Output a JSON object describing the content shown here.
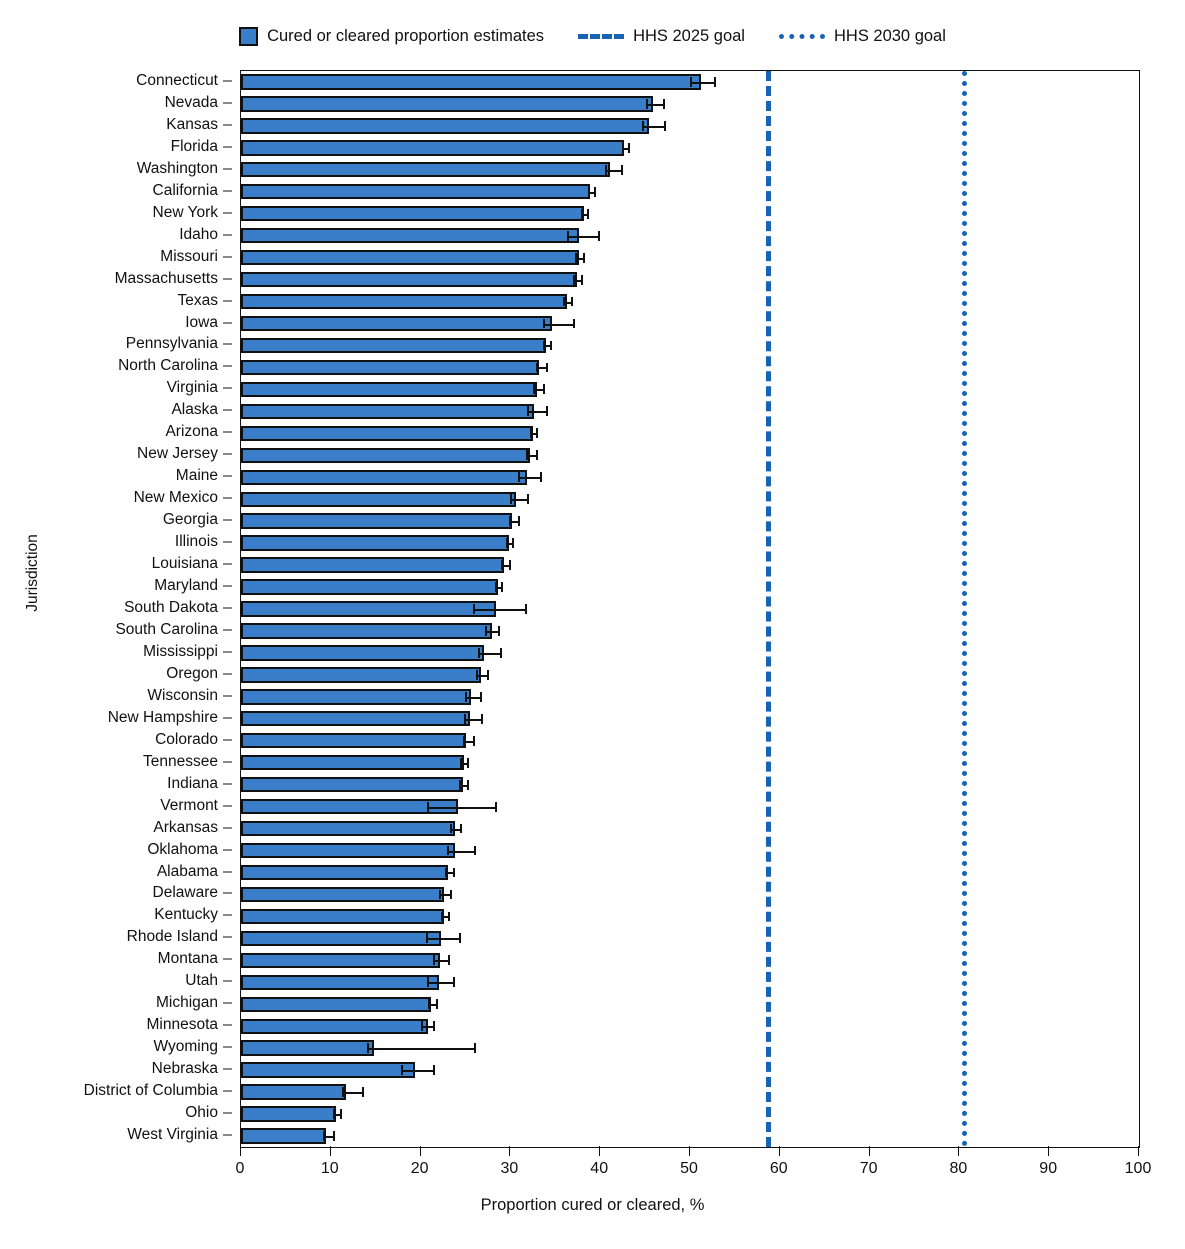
{
  "legend": {
    "items": [
      {
        "name": "bar-series",
        "label": "Cured or cleared proportion estimates",
        "marker": "filled-square",
        "color": "#3A7DC9"
      },
      {
        "name": "hhs-2025-goal",
        "label": "HHS 2025 goal",
        "marker": "dashed-line",
        "color": "#1763B6"
      },
      {
        "name": "hhs-2030-goal",
        "label": "HHS 2030 goal",
        "marker": "dotted-line",
        "color": "#1763B6"
      }
    ]
  },
  "axes": {
    "x_title": "Proportion cured or cleared, %",
    "y_title": "Jurisdiction",
    "x_ticks": [
      0,
      10,
      20,
      30,
      40,
      50,
      60,
      70,
      80,
      90,
      100
    ]
  },
  "chart_data": {
    "type": "bar",
    "orientation": "horizontal",
    "title": "",
    "xlabel": "Proportion cured or cleared, %",
    "ylabel": "Jurisdiction",
    "xlim": [
      0,
      100
    ],
    "xticks": [
      0,
      10,
      20,
      30,
      40,
      50,
      60,
      70,
      80,
      90,
      100
    ],
    "grid": false,
    "legend_position": "top-center",
    "bar_color": "#3A7DC9",
    "bar_edge_color": "#111111",
    "error_bars": "95% confidence interval",
    "reference_lines": [
      {
        "label": "HHS 2025 goal",
        "value": 58.5,
        "style": "dashed",
        "color": "#1763B6"
      },
      {
        "label": "HHS 2030 goal",
        "value": 80.3,
        "style": "dotted",
        "color": "#1763B6"
      }
    ],
    "categories": [
      "Connecticut",
      "Nevada",
      "Kansas",
      "Florida",
      "Washington",
      "California",
      "New York",
      "Idaho",
      "Missouri",
      "Massachusetts",
      "Texas",
      "Iowa",
      "Pennsylvania",
      "North Carolina",
      "Virginia",
      "Alaska",
      "Arizona",
      "New Jersey",
      "Maine",
      "New Mexico",
      "Georgia",
      "Illinois",
      "Louisiana",
      "Maryland",
      "South Dakota",
      "South Carolina",
      "Mississippi",
      "Oregon",
      "Wisconsin",
      "New Hampshire",
      "Colorado",
      "Tennessee",
      "Indiana",
      "Vermont",
      "Arkansas",
      "Oklahoma",
      "Alabama",
      "Delaware",
      "Kentucky",
      "Rhode Island",
      "Montana",
      "Utah",
      "Michigan",
      "Minnesota",
      "Wyoming",
      "Nebraska",
      "District of Columbia",
      "Ohio",
      "West Virginia"
    ],
    "values": [
      51.2,
      45.9,
      45.4,
      42.7,
      41.1,
      38.9,
      38.2,
      37.6,
      37.6,
      37.4,
      36.3,
      34.6,
      34.0,
      33.2,
      33.0,
      32.6,
      32.5,
      32.2,
      31.8,
      30.6,
      30.2,
      29.8,
      29.3,
      28.6,
      28.4,
      27.9,
      27.1,
      26.7,
      25.6,
      25.5,
      25.1,
      24.8,
      24.7,
      24.2,
      23.8,
      23.8,
      23.1,
      22.6,
      22.6,
      22.3,
      22.2,
      22.1,
      21.2,
      20.8,
      14.8,
      19.4,
      11.7,
      10.6,
      9.5
    ],
    "ci_low": [
      50.0,
      45.1,
      44.6,
      42.4,
      40.5,
      38.6,
      37.9,
      36.3,
      37.2,
      37.0,
      35.9,
      33.6,
      33.6,
      32.8,
      32.5,
      31.8,
      32.2,
      31.7,
      30.9,
      29.9,
      29.8,
      29.5,
      28.9,
      28.3,
      25.8,
      27.2,
      26.4,
      26.2,
      24.9,
      24.8,
      24.7,
      24.4,
      24.3,
      20.7,
      23.3,
      22.9,
      22.7,
      22.1,
      22.3,
      20.6,
      21.4,
      20.7,
      20.8,
      20.1,
      14.0,
      17.8,
      11.2,
      10.3,
      9.1
    ],
    "ci_high": [
      52.7,
      47.0,
      47.1,
      43.1,
      42.3,
      39.3,
      38.5,
      39.7,
      38.1,
      37.9,
      36.7,
      37.0,
      34.4,
      34.0,
      33.6,
      34.0,
      32.9,
      32.9,
      33.3,
      31.8,
      30.8,
      30.2,
      29.8,
      29.0,
      31.6,
      28.6,
      28.8,
      27.4,
      26.6,
      26.7,
      25.8,
      25.2,
      25.2,
      28.3,
      24.4,
      25.9,
      23.6,
      23.3,
      23.0,
      24.3,
      23.1,
      23.6,
      21.7,
      21.4,
      25.9,
      21.4,
      13.5,
      11.0,
      10.2
    ]
  }
}
